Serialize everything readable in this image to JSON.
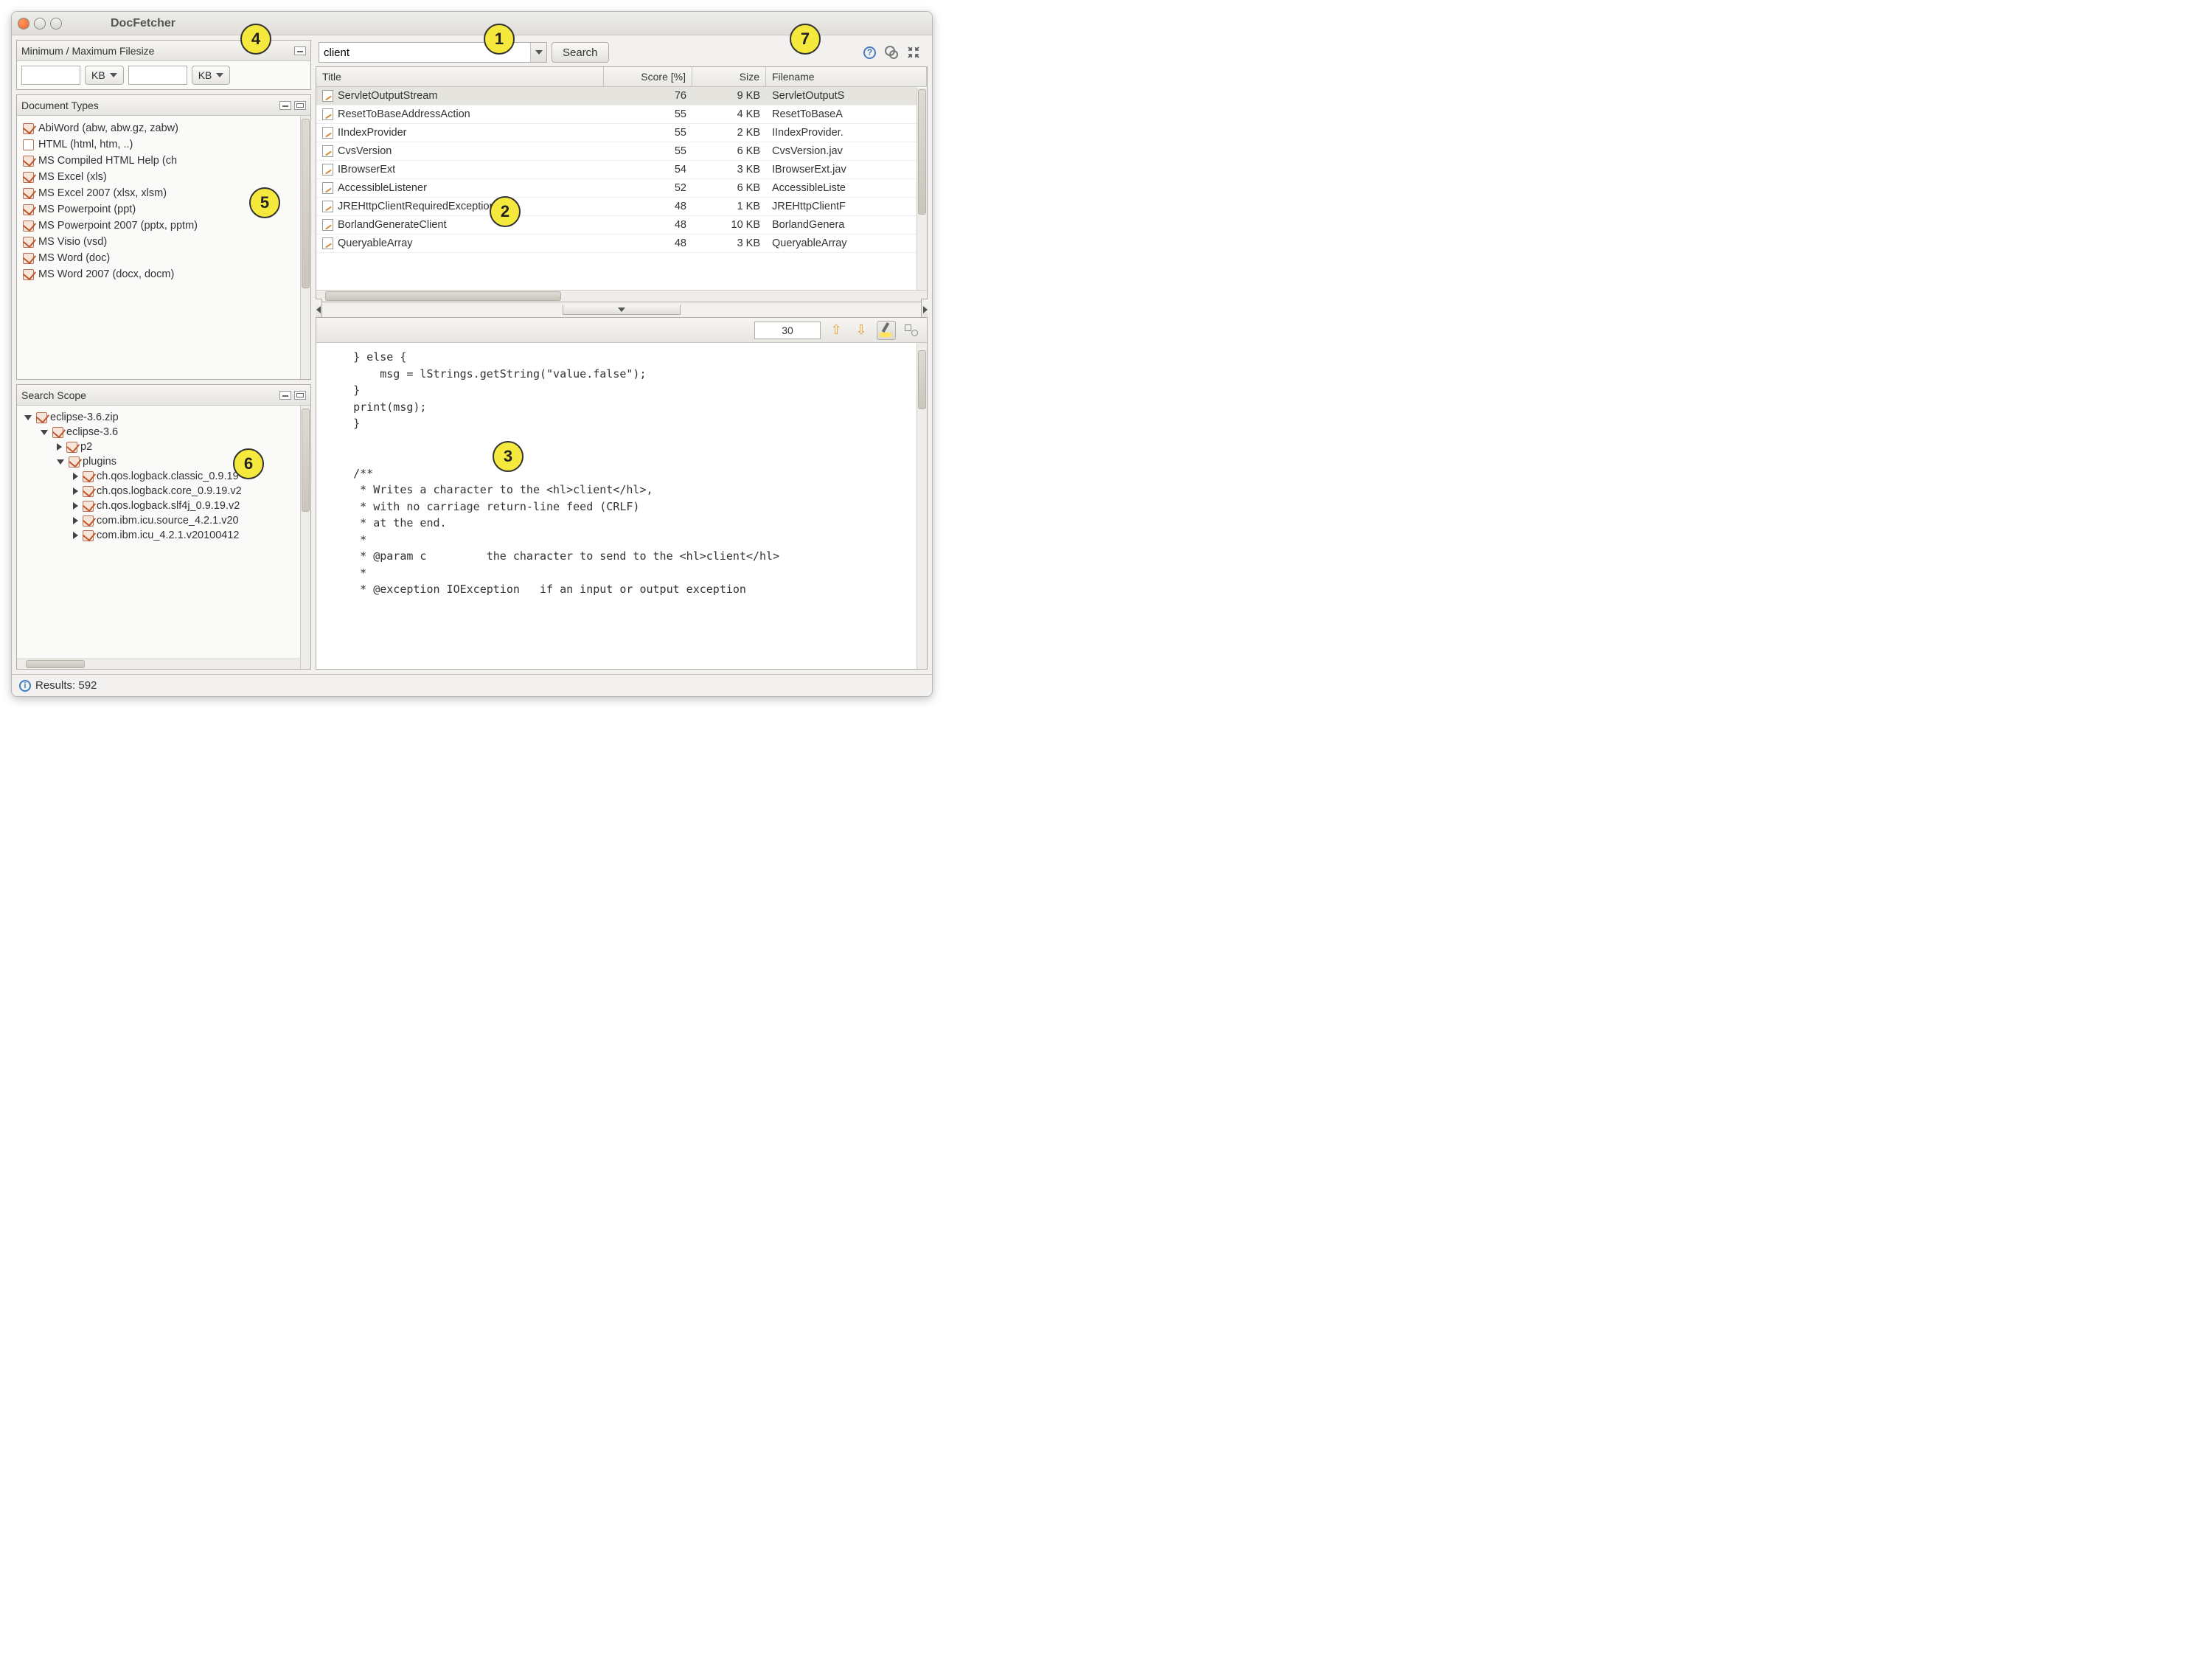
{
  "window": {
    "title": "DocFetcher"
  },
  "callouts": {
    "c1": "1",
    "c2": "2",
    "c3": "3",
    "c4": "4",
    "c5": "5",
    "c6": "6",
    "c7": "7"
  },
  "filesize": {
    "panel_title": "Minimum / Maximum Filesize",
    "min_value": "",
    "min_unit": "KB",
    "max_value": "",
    "max_unit": "KB"
  },
  "doctypes": {
    "panel_title": "Document Types",
    "items": [
      {
        "label": "AbiWord (abw, abw.gz, zabw)",
        "checked": true
      },
      {
        "label": "HTML (html, htm, ..)",
        "checked": false
      },
      {
        "label": "MS Compiled HTML Help (ch",
        "checked": true
      },
      {
        "label": "MS Excel (xls)",
        "checked": true
      },
      {
        "label": "MS Excel 2007 (xlsx, xlsm)",
        "checked": true
      },
      {
        "label": "MS Powerpoint (ppt)",
        "checked": true
      },
      {
        "label": "MS Powerpoint 2007 (pptx, pptm)",
        "checked": true
      },
      {
        "label": "MS Visio (vsd)",
        "checked": true
      },
      {
        "label": "MS Word (doc)",
        "checked": true
      },
      {
        "label": "MS Word 2007 (docx, docm)",
        "checked": true
      }
    ]
  },
  "scope": {
    "panel_title": "Search Scope",
    "tree": [
      {
        "depth": 0,
        "toggle": "open",
        "checked": true,
        "label": "eclipse-3.6.zip"
      },
      {
        "depth": 1,
        "toggle": "open",
        "checked": true,
        "label": "eclipse-3.6"
      },
      {
        "depth": 2,
        "toggle": "closed",
        "checked": true,
        "label": "p2"
      },
      {
        "depth": 2,
        "toggle": "open",
        "checked": true,
        "label": "plugins"
      },
      {
        "depth": 3,
        "toggle": "closed",
        "checked": true,
        "label": "ch.qos.logback.classic_0.9.19"
      },
      {
        "depth": 3,
        "toggle": "closed",
        "checked": true,
        "label": "ch.qos.logback.core_0.9.19.v2"
      },
      {
        "depth": 3,
        "toggle": "closed",
        "checked": true,
        "label": "ch.qos.logback.slf4j_0.9.19.v2"
      },
      {
        "depth": 3,
        "toggle": "closed",
        "checked": true,
        "label": "com.ibm.icu.source_4.2.1.v20"
      },
      {
        "depth": 3,
        "toggle": "closed",
        "checked": true,
        "label": "com.ibm.icu_4.2.1.v20100412"
      }
    ]
  },
  "search": {
    "query": "client",
    "button": "Search"
  },
  "columns": {
    "title": "Title",
    "score": "Score [%]",
    "size": "Size",
    "filename": "Filename"
  },
  "results": [
    {
      "title": "ServletOutputStream",
      "score": "76",
      "size": "9 KB",
      "filename": "ServletOutputS",
      "selected": true
    },
    {
      "title": "ResetToBaseAddressAction",
      "score": "55",
      "size": "4 KB",
      "filename": "ResetToBaseA"
    },
    {
      "title": "IIndexProvider",
      "score": "55",
      "size": "2 KB",
      "filename": "IIndexProvider."
    },
    {
      "title": "CvsVersion",
      "score": "55",
      "size": "6 KB",
      "filename": "CvsVersion.jav"
    },
    {
      "title": "IBrowserExt",
      "score": "54",
      "size": "3 KB",
      "filename": "IBrowserExt.jav"
    },
    {
      "title": "AccessibleListener",
      "score": "52",
      "size": "6 KB",
      "filename": "AccessibleListe"
    },
    {
      "title": "JREHttpClientRequiredException",
      "score": "48",
      "size": "1 KB",
      "filename": "JREHttpClientF"
    },
    {
      "title": "BorlandGenerateClient",
      "score": "48",
      "size": "10 KB",
      "filename": "BorlandGenera"
    },
    {
      "title": "QueryableArray",
      "score": "48",
      "size": "3 KB",
      "filename": "QueryableArray"
    }
  ],
  "preview": {
    "occurrence_count": "30",
    "code_lines": [
      "    } else {",
      "        msg = lStrings.getString(\"value.false\");",
      "    }",
      "    print(msg);",
      "    }",
      "",
      "",
      "    /**",
      "     * Writes a character to the <hl>client</hl>,",
      "     * with no carriage return-line feed (CRLF)",
      "     * at the end.",
      "     *",
      "     * @param c         the character to send to the <hl>client</hl>",
      "     *",
      "     * @exception IOException   if an input or output exception"
    ]
  },
  "status": {
    "text": "Results: 592"
  }
}
